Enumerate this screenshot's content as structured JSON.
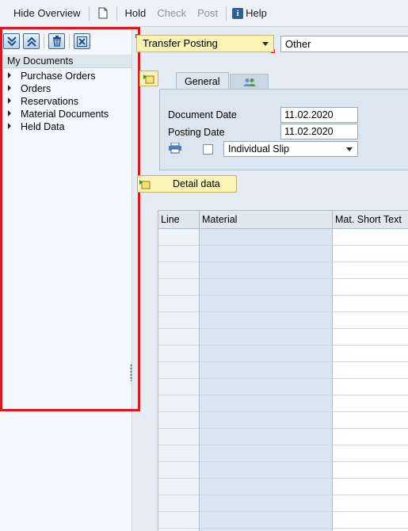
{
  "toolbar": {
    "hide_overview": "Hide Overview",
    "document_icon": "document-icon",
    "hold": "Hold",
    "check": "Check",
    "post": "Post",
    "help_icon_glyph": "i",
    "help": "Help"
  },
  "left_panel": {
    "tools": [
      "expand-all-icon",
      "collapse-all-icon",
      "delete-icon",
      "close-icon"
    ],
    "tree_header": "My Documents",
    "items": [
      {
        "label": "Purchase Orders"
      },
      {
        "label": "Orders"
      },
      {
        "label": "Reservations"
      },
      {
        "label": "Material Documents"
      },
      {
        "label": "Held Data"
      }
    ]
  },
  "transaction": {
    "action_selected": "Transfer Posting",
    "reference_selected": "Other"
  },
  "tabs": [
    {
      "label": "General",
      "active": true
    },
    {
      "label": "",
      "icon": "persons-icon",
      "active": false
    }
  ],
  "header_fields": {
    "document_date_label": "Document Date",
    "document_date_value": "11.02.2020",
    "posting_date_label": "Posting Date",
    "posting_date_value": "11.02.2020",
    "print_checked": false,
    "slip_selected": "Individual Slip"
  },
  "detail_button": {
    "label": "Detail data"
  },
  "table": {
    "columns": [
      "Line",
      "Material",
      "Mat. Short Text"
    ],
    "rows": []
  },
  "colors": {
    "highlight_border": "#e0161e",
    "yellow_field": "#fbf3b5",
    "panel_bg": "#dce6f0"
  }
}
